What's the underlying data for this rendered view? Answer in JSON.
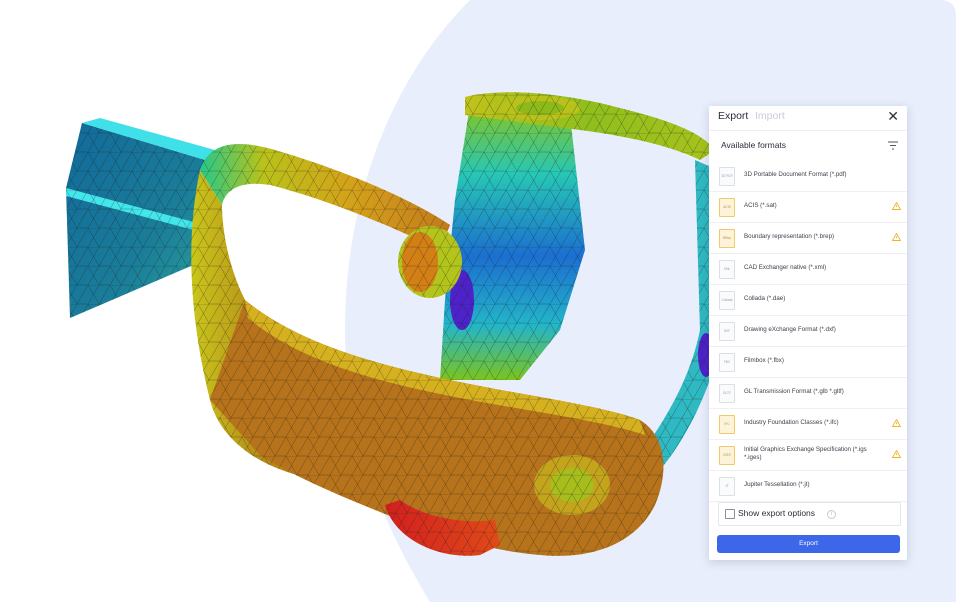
{
  "panel": {
    "tabs": [
      {
        "label": "Export",
        "active": true
      },
      {
        "label": "Import",
        "active": false
      }
    ],
    "close_glyph": "✕",
    "section_title": "Available formats",
    "formats": [
      {
        "name": "3D Portable Document Format (*.pdf)",
        "icon_text": "3D PDF",
        "warning": false
      },
      {
        "name": "ACIS (*.sat)",
        "icon_text": "ACIS",
        "warning": true
      },
      {
        "name": "Boundary representation (*.brep)",
        "icon_text": "BRep",
        "warning": true
      },
      {
        "name": "CAD Exchanger native (*.xml)",
        "icon_text": "XML",
        "warning": false
      },
      {
        "name": "Collada (*.dae)",
        "icon_text": "Collada",
        "warning": false
      },
      {
        "name": "Drawing eXchange Format (*.dxf)",
        "icon_text": "DXF",
        "warning": false
      },
      {
        "name": "Filmbox (*.fbx)",
        "icon_text": "FBX",
        "warning": false
      },
      {
        "name": "GL Transmission Format (*.glb *.gltf)",
        "icon_text": "GLTF",
        "warning": false
      },
      {
        "name": "Industry Foundation Classes (*.ifc)",
        "icon_text": "IFC",
        "warning": true
      },
      {
        "name": "Initial Graphics Exchange Specification (*.igs *.iges)",
        "icon_text": "IGES",
        "warning": true
      },
      {
        "name": "Jupiter Tessellation (*.jt)",
        "icon_text": "JT",
        "warning": false
      }
    ],
    "show_options_label": "Show export options",
    "show_options_checked": false,
    "info_glyph": "i",
    "export_button": "Export"
  },
  "colors": {
    "accent": "#3b67e8",
    "warning": "#f0b429",
    "background_shape": "#e8eefb"
  }
}
